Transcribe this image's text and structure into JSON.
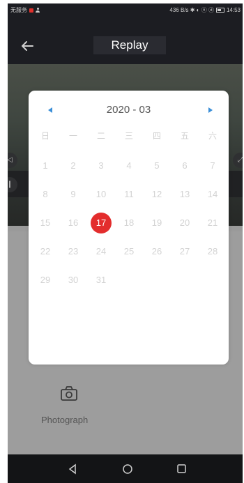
{
  "status_bar": {
    "carrier": "无服务",
    "right_text": "436 B/s ✱ ◐ ⓝ ⓓ",
    "time": "14:53"
  },
  "header": {
    "title": "Replay"
  },
  "calendar": {
    "month_label": "2020 - 03",
    "weekdays": [
      "日",
      "一",
      "二",
      "三",
      "四",
      "五",
      "六"
    ],
    "weeks": [
      [
        "1",
        "2",
        "3",
        "4",
        "5",
        "6",
        "7"
      ],
      [
        "8",
        "9",
        "10",
        "11",
        "12",
        "13",
        "14"
      ],
      [
        "15",
        "16",
        "17",
        "18",
        "19",
        "20",
        "21"
      ],
      [
        "22",
        "23",
        "24",
        "25",
        "26",
        "27",
        "28"
      ],
      [
        "29",
        "30",
        "31",
        "",
        "",
        "",
        ""
      ]
    ],
    "selected_day": "17",
    "accent_color": "#e32d2d",
    "arrow_color": "#3b8fd8"
  },
  "bottom": {
    "photo_label": "Photograph"
  },
  "icons": {
    "back": "arrow-left-icon",
    "camera": "camera-icon",
    "nav_back": "triangle-back-icon",
    "nav_home": "circle-home-icon",
    "nav_recent": "square-recent-icon"
  }
}
